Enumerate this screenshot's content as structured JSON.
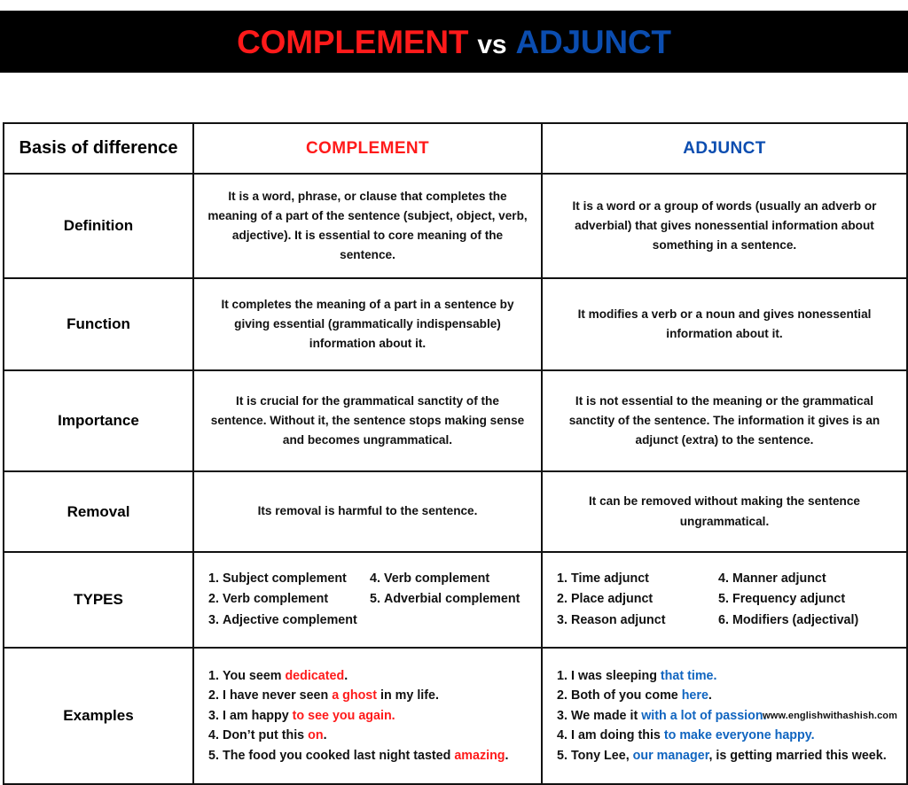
{
  "title": {
    "part1": "COMPLEMENT",
    "connector": "vs",
    "part2": "ADJUNCT",
    "color_part1": "#ff1a1a",
    "color_connector": "#ffffff",
    "color_part2": "#0b4db0",
    "background": "#000000"
  },
  "table": {
    "headers": {
      "basis": "Basis of difference",
      "complement": "COMPLEMENT",
      "adjunct": "ADJUNCT"
    },
    "rows": {
      "definition": {
        "label": "Definition",
        "complement": "It is a word, phrase, or clause that completes the meaning of a part of the sentence (subject, object, verb, adjective). It is essential to core meaning of the sentence.",
        "adjunct": "It is a word or a group of words (usually an adverb or adverbial) that gives nonessential information about something in a sentence."
      },
      "function": {
        "label": "Function",
        "complement": "It completes the meaning of a part in a sentence by giving essential (grammatically indispensable) information about it.",
        "adjunct": "It modifies a verb or a noun and gives nonessential information about it."
      },
      "importance": {
        "label": "Importance",
        "complement": "It is crucial for the grammatical sanctity of the sentence. Without it, the sentence stops making sense and becomes ungrammatical.",
        "adjunct": "It is not essential to the meaning or the grammatical sanctity of the sentence. The information it gives is an adjunct (extra) to the sentence."
      },
      "removal": {
        "label": "Removal",
        "complement": "Its removal is harmful to the sentence.",
        "adjunct": "It can be removed without making the sentence ungrammatical."
      },
      "types": {
        "label": "TYPES",
        "complement_col1": [
          {
            "num": "1.",
            "text": "Subject complement"
          },
          {
            "num": "2.",
            "text": "Verb complement"
          },
          {
            "num": "3.",
            "text": "Adjective complement"
          }
        ],
        "complement_col2": [
          {
            "num": "4.",
            "text": "Verb complement"
          },
          {
            "num": "5.",
            "text": "Adverbial complement"
          }
        ],
        "adjunct_col1": [
          {
            "num": "1.",
            "text": "Time adjunct"
          },
          {
            "num": "2.",
            "text": "Place adjunct"
          },
          {
            "num": "3.",
            "text": "Reason adjunct"
          }
        ],
        "adjunct_col2": [
          {
            "num": "4.",
            "text": "Manner adjunct"
          },
          {
            "num": "5.",
            "text": "Frequency adjunct"
          },
          {
            "num": "6.",
            "text": "Modifiers (adjectival)"
          }
        ]
      },
      "examples": {
        "label": "Examples",
        "complement": [
          {
            "num": "1.",
            "pre": "You seem ",
            "hl": "dedicated",
            "post": "."
          },
          {
            "num": "2.",
            "pre": "I have never seen ",
            "hl": "a ghost",
            "post": " in my life."
          },
          {
            "num": "3.",
            "pre": "I am happy ",
            "hl": "to see you again.",
            "post": ""
          },
          {
            "num": "4.",
            "pre": "Don’t put this ",
            "hl": "on",
            "post": "."
          },
          {
            "num": "5.",
            "pre": "The food you cooked last night tasted ",
            "hl": "amazing",
            "post": "."
          }
        ],
        "adjunct": [
          {
            "num": "1.",
            "pre": "I was sleeping ",
            "hl": "that time.",
            "post": ""
          },
          {
            "num": "2.",
            "pre": "Both of you come ",
            "hl": "here",
            "post": "."
          },
          {
            "num": "3.",
            "pre": "We made it ",
            "hl": "with a lot of passion.",
            "post": ""
          },
          {
            "num": "4.",
            "pre": "I am doing this ",
            "hl": "to make everyone happy.",
            "post": ""
          },
          {
            "num": "5.",
            "pre": "Tony Lee, ",
            "hl": "our manager",
            "post": ", is getting married this week."
          }
        ],
        "highlight_color_complement": "#ff1a1a",
        "highlight_color_adjunct": "#1065c0"
      }
    }
  },
  "footer": {
    "credit": "www.englishwithashish.com"
  }
}
